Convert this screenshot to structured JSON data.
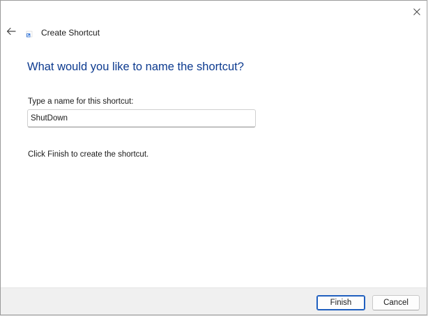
{
  "window": {
    "title": "Create Shortcut"
  },
  "main": {
    "heading": "What would you like to name the shortcut?",
    "field_label": "Type a name for this shortcut:",
    "name_value": "ShutDown",
    "hint": "Click Finish to create the shortcut."
  },
  "footer": {
    "finish_label": "Finish",
    "cancel_label": "Cancel"
  },
  "icons": {
    "close": "close-icon",
    "back": "back-arrow-icon",
    "app": "shortcut-icon"
  },
  "colors": {
    "heading": "#0c3a8f",
    "accent": "#1f5fbf",
    "footer_bg": "#f0f0f0"
  }
}
